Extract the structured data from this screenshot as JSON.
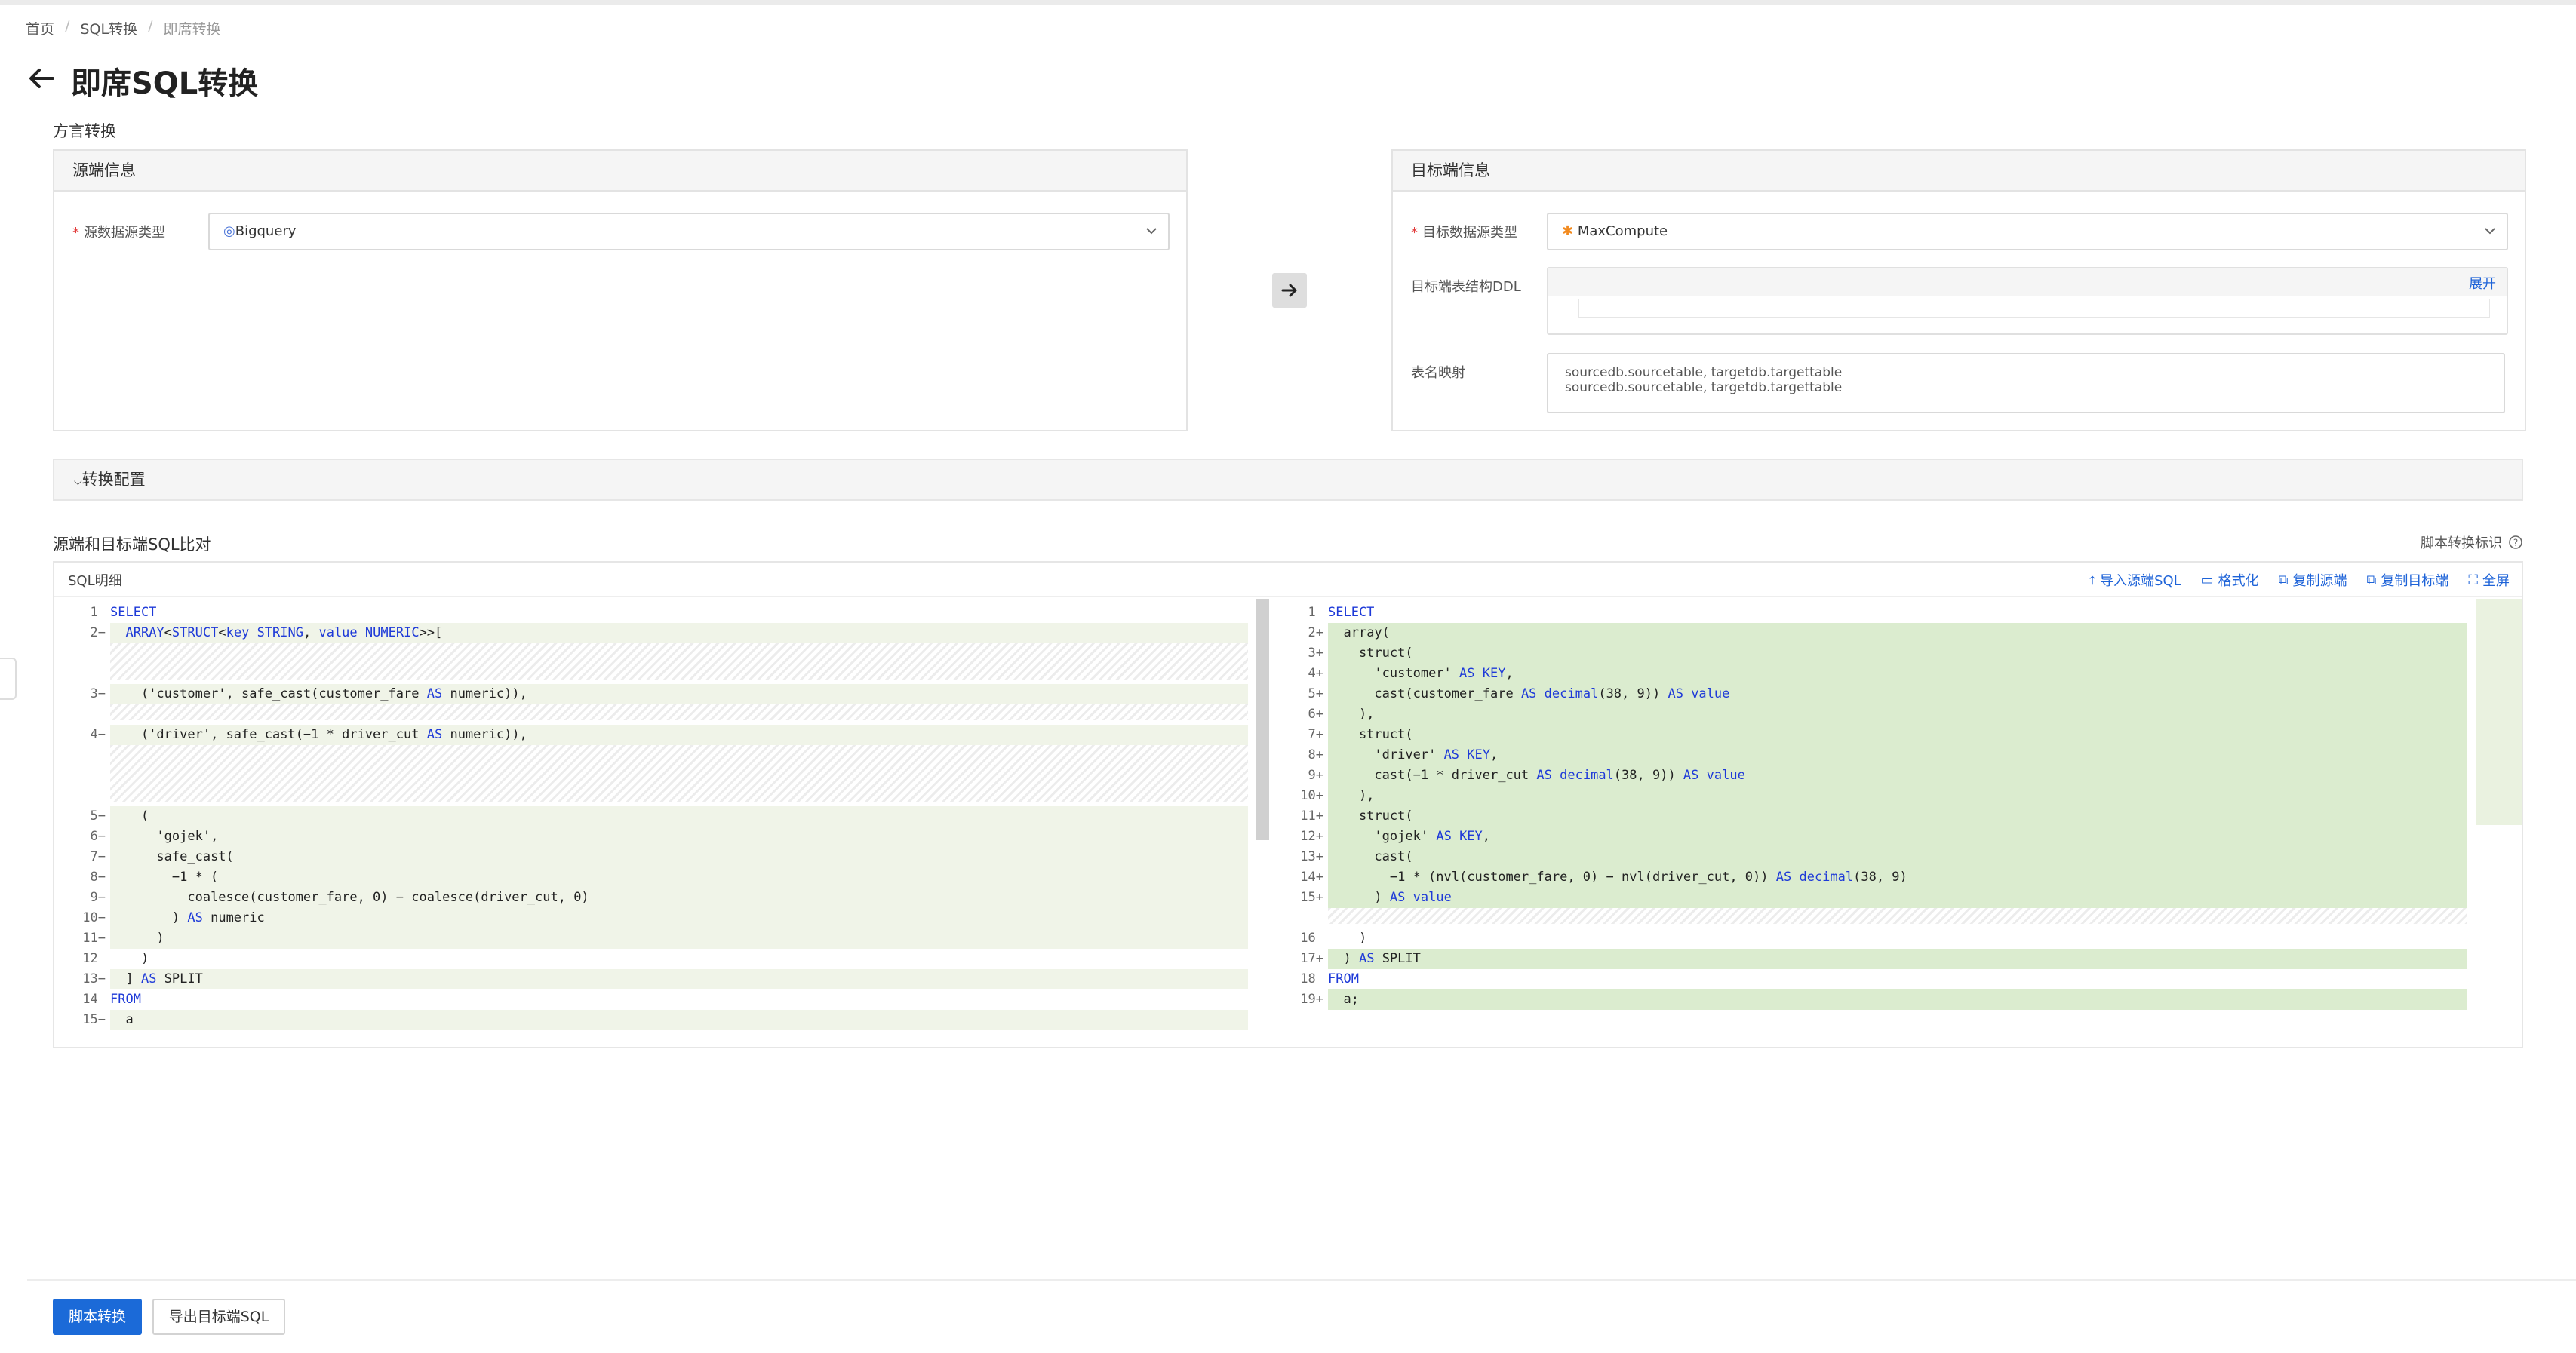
{
  "breadcrumb": [
    "首页",
    "SQL转换",
    "即席转换"
  ],
  "page_title": "即席SQL转换",
  "section_title": "方言转换",
  "source": {
    "header": "源端信息",
    "type_label": "源数据源类型",
    "type_value": "Bigquery"
  },
  "target": {
    "header": "目标端信息",
    "type_label": "目标数据源类型",
    "type_value": "MaxCompute",
    "ddl_label": "目标端表结构DDL",
    "expand": "展开",
    "mapping_label": "表名映射",
    "mapping_lines": [
      "sourcedb.sourcetable, targetdb.targettable",
      "sourcedb.sourcetable, targetdb.targettable"
    ]
  },
  "config_bar": "转换配置",
  "compare_title": "源端和目标端SQL比对",
  "compare_hint": "脚本转换标识",
  "sql_detail_label": "SQL明细",
  "toolbar": {
    "import": "导入源端SQL",
    "format": "格式化",
    "copy_source": "复制源端",
    "copy_target": "复制目标端",
    "fullscreen": "全屏"
  },
  "left_code": [
    {
      "n": "1",
      "m": "",
      "t": "SELECT"
    },
    {
      "n": "2",
      "m": "−",
      "t": "  ARRAY<STRUCT<key STRING, value NUMERIC>>["
    },
    {
      "n": "3",
      "m": "−",
      "t": "    ('customer', safe_cast(customer_fare AS numeric)),"
    },
    {
      "n": "4",
      "m": "−",
      "t": "    ('driver', safe_cast(−1 * driver_cut AS numeric)),"
    },
    {
      "n": "5",
      "m": "−",
      "t": "    ("
    },
    {
      "n": "6",
      "m": "−",
      "t": "      'gojek',"
    },
    {
      "n": "7",
      "m": "−",
      "t": "      safe_cast("
    },
    {
      "n": "8",
      "m": "−",
      "t": "        −1 * ("
    },
    {
      "n": "9",
      "m": "−",
      "t": "          coalesce(customer_fare, 0) − coalesce(driver_cut, 0)"
    },
    {
      "n": "10",
      "m": "−",
      "t": "        ) AS numeric"
    },
    {
      "n": "11",
      "m": "−",
      "t": "      )"
    },
    {
      "n": "12",
      "m": "",
      "t": "    )"
    },
    {
      "n": "13",
      "m": "−",
      "t": "  ] AS SPLIT"
    },
    {
      "n": "14",
      "m": "",
      "t": "FROM"
    },
    {
      "n": "15",
      "m": "−",
      "t": "  a"
    }
  ],
  "right_code": [
    {
      "n": "1",
      "m": "",
      "t": "SELECT"
    },
    {
      "n": "2",
      "m": "+",
      "t": "  array("
    },
    {
      "n": "3",
      "m": "+",
      "t": "    struct("
    },
    {
      "n": "4",
      "m": "+",
      "t": "      'customer' AS KEY,"
    },
    {
      "n": "5",
      "m": "+",
      "t": "      cast(customer_fare AS decimal(38, 9)) AS value"
    },
    {
      "n": "6",
      "m": "+",
      "t": "    ),"
    },
    {
      "n": "7",
      "m": "+",
      "t": "    struct("
    },
    {
      "n": "8",
      "m": "+",
      "t": "      'driver' AS KEY,"
    },
    {
      "n": "9",
      "m": "+",
      "t": "      cast(−1 * driver_cut AS decimal(38, 9)) AS value"
    },
    {
      "n": "10",
      "m": "+",
      "t": "    ),"
    },
    {
      "n": "11",
      "m": "+",
      "t": "    struct("
    },
    {
      "n": "12",
      "m": "+",
      "t": "      'gojek' AS KEY,"
    },
    {
      "n": "13",
      "m": "+",
      "t": "      cast("
    },
    {
      "n": "14",
      "m": "+",
      "t": "        −1 * (nvl(customer_fare, 0) − nvl(driver_cut, 0)) AS decimal(38, 9)"
    },
    {
      "n": "15",
      "m": "+",
      "t": "      ) AS value"
    },
    {
      "n": "16",
      "m": "",
      "t": "    )"
    },
    {
      "n": "17",
      "m": "+",
      "t": "  ) AS SPLIT"
    },
    {
      "n": "18",
      "m": "",
      "t": "FROM"
    },
    {
      "n": "19",
      "m": "+",
      "t": "  a;"
    }
  ],
  "footer": {
    "convert": "脚本转换",
    "export": "导出目标端SQL"
  },
  "colors": {
    "primary": "#1b6ad8",
    "keyword": "#1e3ad8",
    "added": "#dbeccf",
    "removed": "#f0f4e8"
  }
}
